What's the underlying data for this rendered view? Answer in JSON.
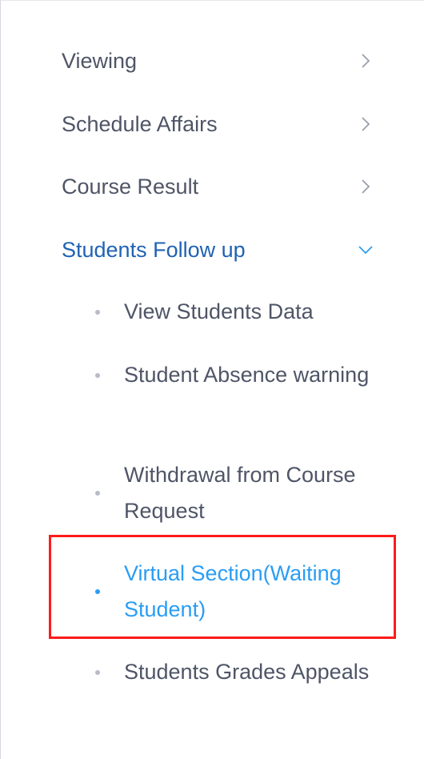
{
  "menu": {
    "items": [
      {
        "label": "Viewing",
        "expanded": false
      },
      {
        "label": "Schedule Affairs",
        "expanded": false
      },
      {
        "label": "Course Result",
        "expanded": false
      },
      {
        "label": "Students Follow up",
        "expanded": true
      }
    ],
    "sub_items": [
      {
        "label": "View Students Data",
        "selected": false
      },
      {
        "label": "Student Absence warning",
        "selected": false
      },
      {
        "label": "Withdrawal from Course Request",
        "selected": false
      },
      {
        "label": "Virtual Section(Waiting Student)",
        "selected": true
      },
      {
        "label": "Students Grades Appeals",
        "selected": false
      }
    ]
  },
  "colors": {
    "text": "#4e5566",
    "active_parent": "#1f63b3",
    "selected_child": "#2a9df4",
    "bullet": "#b7bcc6",
    "highlight_border": "#ff1a1a"
  },
  "icons": {
    "collapsed": "chevron-right-icon",
    "expanded": "chevron-down-icon",
    "bullet": "bullet-dot-icon"
  }
}
